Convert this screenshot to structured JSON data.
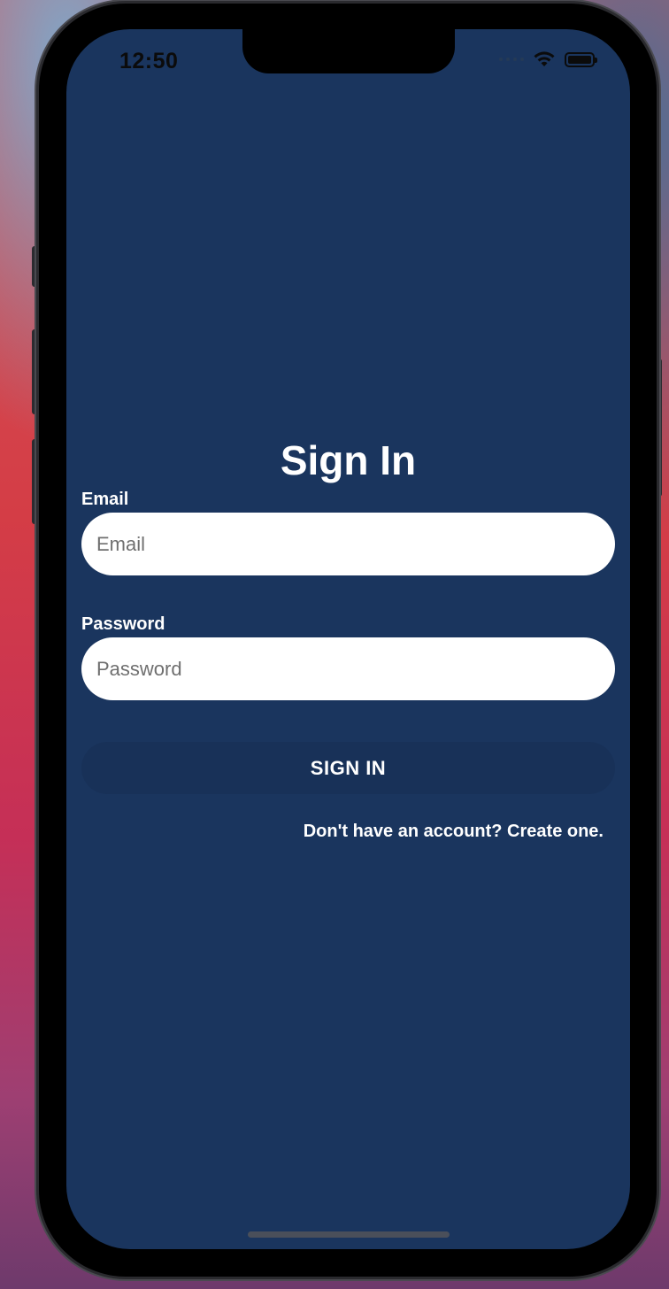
{
  "status_bar": {
    "time": "12:50",
    "icons": [
      "signal-dots-icon",
      "wifi-icon",
      "battery-icon"
    ]
  },
  "screen": {
    "title": "Sign In",
    "background_color": "#1a355e"
  },
  "form": {
    "email": {
      "label": "Email",
      "placeholder": "Email",
      "value": ""
    },
    "password": {
      "label": "Password",
      "placeholder": "Password",
      "value": ""
    },
    "submit_label": "SIGN IN",
    "create_account_link": "Don't have an account? Create one."
  }
}
